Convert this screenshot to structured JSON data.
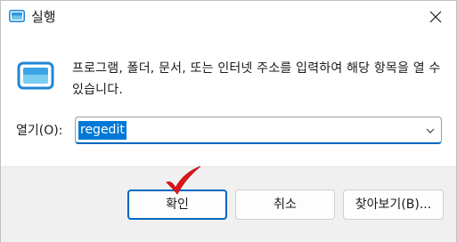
{
  "window": {
    "title": "실행",
    "icon": "run-dialog-icon",
    "close": "close-icon"
  },
  "body": {
    "description": "프로그램, 폴더, 문서, 또는 인터넷 주소를 입력하여 해당 항목을 열 수 있습니다.",
    "open_label": "열기(O):",
    "open_value": "regedit"
  },
  "buttons": {
    "ok": "확인",
    "cancel": "취소",
    "browse": "찾아보기(B)..."
  },
  "colors": {
    "accent": "#0067c0",
    "selection": "#0078d7",
    "annotation": "#e0151b"
  },
  "annotation": "red-checkmark"
}
